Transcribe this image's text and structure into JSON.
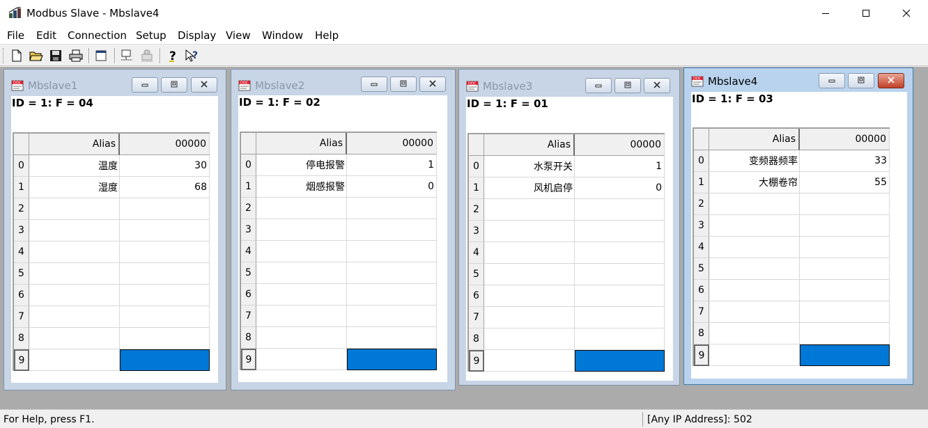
{
  "app": {
    "title": "Modbus Slave - Mbslave4"
  },
  "menu": [
    "File",
    "Edit",
    "Connection",
    "Setup",
    "Display",
    "View",
    "Window",
    "Help"
  ],
  "toolbar": {
    "buttons": [
      "new-document-icon",
      "open-folder-icon",
      "save-icon",
      "print-icon",
      "window-icon",
      "connect-icon",
      "disconnect-icon",
      "help-icon",
      "context-help-icon"
    ]
  },
  "windows": [
    {
      "title": "Mbslave1",
      "info": "ID = 1: F = 04",
      "active": false,
      "alias_header": "Alias",
      "value_header": "00000",
      "rows": [
        {
          "index": "0",
          "alias": "温度",
          "value": "30"
        },
        {
          "index": "1",
          "alias": "湿度",
          "value": "68"
        },
        {
          "index": "2",
          "alias": "",
          "value": ""
        },
        {
          "index": "3",
          "alias": "",
          "value": ""
        },
        {
          "index": "4",
          "alias": "",
          "value": ""
        },
        {
          "index": "5",
          "alias": "",
          "value": ""
        },
        {
          "index": "6",
          "alias": "",
          "value": ""
        },
        {
          "index": "7",
          "alias": "",
          "value": ""
        },
        {
          "index": "8",
          "alias": "",
          "value": ""
        },
        {
          "index": "9",
          "alias": "",
          "value": ""
        }
      ]
    },
    {
      "title": "Mbslave2",
      "info": "ID = 1: F = 02",
      "active": false,
      "alias_header": "Alias",
      "value_header": "00000",
      "rows": [
        {
          "index": "0",
          "alias": "停电报警",
          "value": "1"
        },
        {
          "index": "1",
          "alias": "烟感报警",
          "value": "0"
        },
        {
          "index": "2",
          "alias": "",
          "value": ""
        },
        {
          "index": "3",
          "alias": "",
          "value": ""
        },
        {
          "index": "4",
          "alias": "",
          "value": ""
        },
        {
          "index": "5",
          "alias": "",
          "value": ""
        },
        {
          "index": "6",
          "alias": "",
          "value": ""
        },
        {
          "index": "7",
          "alias": "",
          "value": ""
        },
        {
          "index": "8",
          "alias": "",
          "value": ""
        },
        {
          "index": "9",
          "alias": "",
          "value": ""
        }
      ]
    },
    {
      "title": "Mbslave3",
      "info": "ID = 1: F = 01",
      "active": false,
      "alias_header": "Alias",
      "value_header": "00000",
      "rows": [
        {
          "index": "0",
          "alias": "水泵开关",
          "value": "1"
        },
        {
          "index": "1",
          "alias": "风机启停",
          "value": "0"
        },
        {
          "index": "2",
          "alias": "",
          "value": ""
        },
        {
          "index": "3",
          "alias": "",
          "value": ""
        },
        {
          "index": "4",
          "alias": "",
          "value": ""
        },
        {
          "index": "5",
          "alias": "",
          "value": ""
        },
        {
          "index": "6",
          "alias": "",
          "value": ""
        },
        {
          "index": "7",
          "alias": "",
          "value": ""
        },
        {
          "index": "8",
          "alias": "",
          "value": ""
        },
        {
          "index": "9",
          "alias": "",
          "value": ""
        }
      ]
    },
    {
      "title": "Mbslave4",
      "info": "ID = 1: F = 03",
      "active": true,
      "alias_header": "Alias",
      "value_header": "00000",
      "rows": [
        {
          "index": "0",
          "alias": "变频器频率",
          "value": "33"
        },
        {
          "index": "1",
          "alias": "大棚卷帘",
          "value": "55"
        },
        {
          "index": "2",
          "alias": "",
          "value": ""
        },
        {
          "index": "3",
          "alias": "",
          "value": ""
        },
        {
          "index": "4",
          "alias": "",
          "value": ""
        },
        {
          "index": "5",
          "alias": "",
          "value": ""
        },
        {
          "index": "6",
          "alias": "",
          "value": ""
        },
        {
          "index": "7",
          "alias": "",
          "value": ""
        },
        {
          "index": "8",
          "alias": "",
          "value": ""
        },
        {
          "index": "9",
          "alias": "",
          "value": ""
        }
      ]
    }
  ],
  "status": {
    "help": "For Help, press F1.",
    "address": "[Any IP Address]: 502"
  },
  "colors": {
    "selection": "#0078d7",
    "mdi_background": "#ababab",
    "active_close": "#c2402a"
  }
}
